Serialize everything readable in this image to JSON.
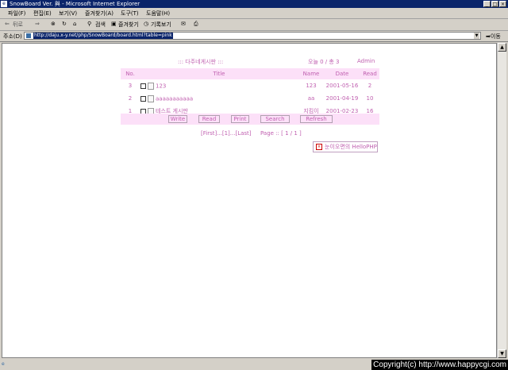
{
  "window": {
    "title": "SnowBoard Ver. 與 - Microsoft Internet Explorer"
  },
  "menu": [
    "파일(F)",
    "편집(E)",
    "보기(V)",
    "즐겨찾기(A)",
    "도구(T)",
    "도움말(H)"
  ],
  "toolbar": {
    "back": "뒤로",
    "forward": "앞으로",
    "search": "검색",
    "favorites": "즐겨찾기",
    "history": "기록보기"
  },
  "address": {
    "label": "주소(D)",
    "url": "http://daju.x-y.net/php/SnowBoard/board.html?table=pink",
    "go": "이동"
  },
  "board": {
    "title": ":::  다주네게시판  :::",
    "meta": "오늘 0 / 총 3",
    "admin": "Admin",
    "columns": [
      "No.",
      "Title",
      "Name",
      "Date",
      "Read"
    ],
    "rows": [
      {
        "no": "3",
        "title": "123",
        "name": "123",
        "date": "2001-05-16",
        "read": "2"
      },
      {
        "no": "2",
        "title": "aaaaaaaaaaa",
        "name": "aa",
        "date": "2001-04-19",
        "read": "10"
      },
      {
        "no": "1",
        "title": "테스트 게시판",
        "name": "지킴이",
        "date": "2001-02-23",
        "read": "16"
      }
    ],
    "buttons": {
      "write": "Write",
      "read": "Read",
      "print": "Print",
      "search": "Search",
      "refresh": "Refresh"
    },
    "pager": "[First]...[1]...[Last]",
    "page_count": "Page :: [ 1 / 1 ]",
    "hello": "눈이오면의 HelloPHP"
  },
  "copyright": "Copyright(c) http://www.happycgi.com"
}
